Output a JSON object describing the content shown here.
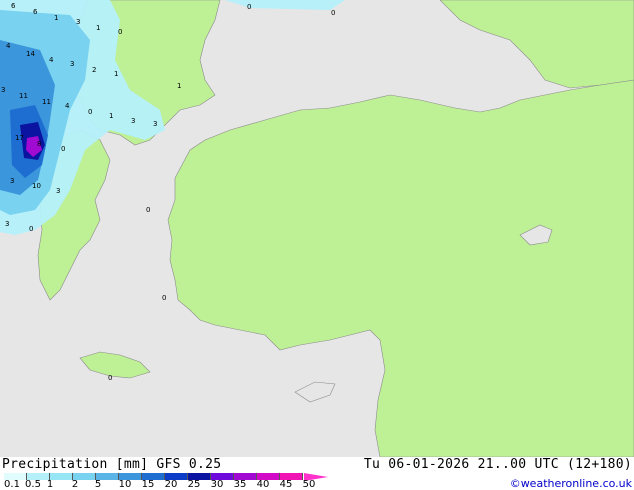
{
  "footer": {
    "title_left": "Precipitation [mm] GFS 0.25",
    "title_right": "Tu 06-01-2026 21..00 UTC (12+180)",
    "credit": "©weatheronline.co.uk"
  },
  "legend": {
    "ticks": [
      "0.1",
      "0.5",
      "1",
      "2",
      "5",
      "10",
      "15",
      "20",
      "25",
      "30",
      "35",
      "40",
      "45",
      "50"
    ],
    "colors": [
      "#e0fcfc",
      "#b4f0fa",
      "#96e6f5",
      "#78d2f0",
      "#5ab4e6",
      "#3c96dc",
      "#1e6ed2",
      "#0a3cc8",
      "#0a14a0",
      "#6e0adc",
      "#a00ad2",
      "#d20ac8",
      "#f014b4"
    ],
    "arrow_color": "#ff33cc"
  },
  "map": {
    "colors": {
      "sea": "#e6e6e6",
      "land": "#bef096",
      "border": "#8c8c8c"
    },
    "labels": [
      "6",
      "6",
      "1",
      "3",
      "1",
      "0",
      "0",
      "4",
      "14",
      "4",
      "3",
      "2",
      "1",
      "3",
      "11",
      "11",
      "4",
      "0",
      "1",
      "3",
      "3",
      "1",
      "17",
      "8",
      "0",
      "3",
      "10",
      "3",
      "3",
      "0",
      "0",
      "0",
      "0",
      "0"
    ]
  }
}
